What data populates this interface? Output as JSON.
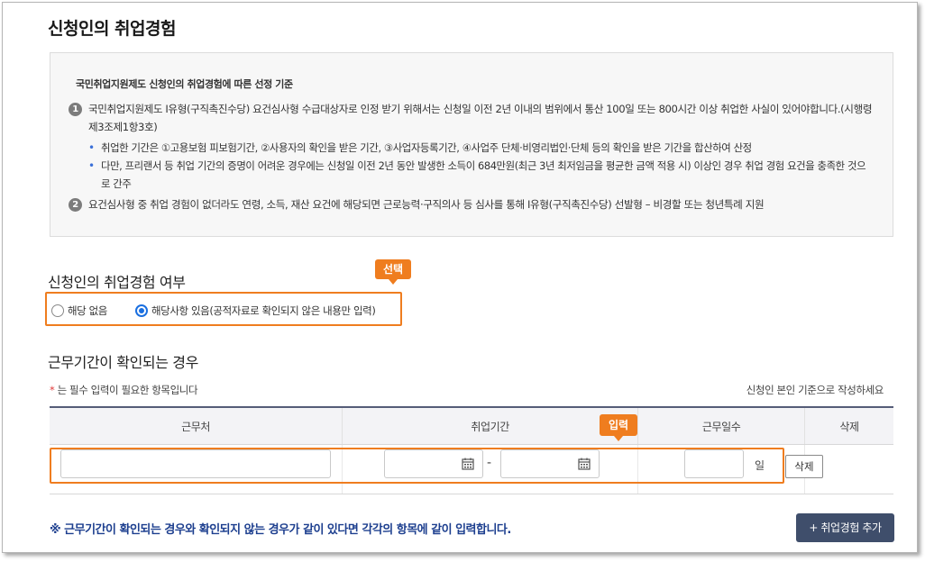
{
  "page_title": "신청인의 취업경험",
  "info": {
    "heading": "국민취업지원제도 신청인의 취업경험에 따른 선정 기준",
    "items": [
      {
        "num": "1",
        "text": "국민취업지원제도 I유형(구직촉진수당) 요건심사형 수급대상자로 인정 받기 위해서는 신청일 이전 2년 이내의 범위에서 통산 100일 또는 800시간 이상 취업한 사실이 있어야합니다.(시행령 제3조제1항3호)"
      },
      {
        "num": "2",
        "text": "요건심사형 중 취업 경험이 없더라도 연령, 소득, 재산 요건에 해당되면 근로능력·구직의사 등 심사를 통해 I유형(구직촉진수당) 선발형 – 비경할 또는 청년특례 지원"
      }
    ],
    "sub_items": [
      "취업한 기간은 ①고용보험 피보험기간, ②사용자의 확인을 받은 기간, ③사업자등록기간, ④사업주 단체·비영리법인·단체 등의 확인을 받은 기간을 합산하여 산정",
      "다만, 프리랜서 등 취업 기간의 증명이 어려운 경우에는 신청일 이전 2년 동안 발생한 소득이 684만원(최근 3년 최저임금을 평균한 금액 적용 시) 이상인 경우 취업 경험 요건을 충족한 것으로 간주"
    ]
  },
  "experience": {
    "title": "신청인의 취업경험 여부",
    "callout": "선택",
    "options": [
      {
        "label": "해당 없음",
        "selected": false
      },
      {
        "label": "해당사항 있음(공적자료로 확인되지 않은 내용만 입력)",
        "selected": true
      }
    ]
  },
  "work_period": {
    "title": "근무기간이 확인되는 경우",
    "required_star": "*",
    "required_note": " 는 필수 입력이 필요한 항목입니다",
    "right_note": "신청인 본인 기준으로 작성하세요",
    "callout": "입력",
    "columns": [
      "근무처",
      "취업기간",
      "근무일수",
      "삭제"
    ],
    "row": {
      "workplace": "",
      "start_date": "",
      "end_date": "",
      "dash": "-",
      "days": "",
      "days_unit": "일",
      "delete_label": "삭제"
    }
  },
  "footer_note": "※ 근무기간이 확인되는 경우와 확인되지 않는 경우가 같이 있다면 각각의 항목에 같이 입력합니다.",
  "add_button": "+ 취업경험 추가",
  "colors": {
    "accent_orange": "#ef7d1f",
    "button_dark": "#3f4e6b",
    "note_blue": "#1d3f8f",
    "radio_blue": "#1a6fe0"
  }
}
